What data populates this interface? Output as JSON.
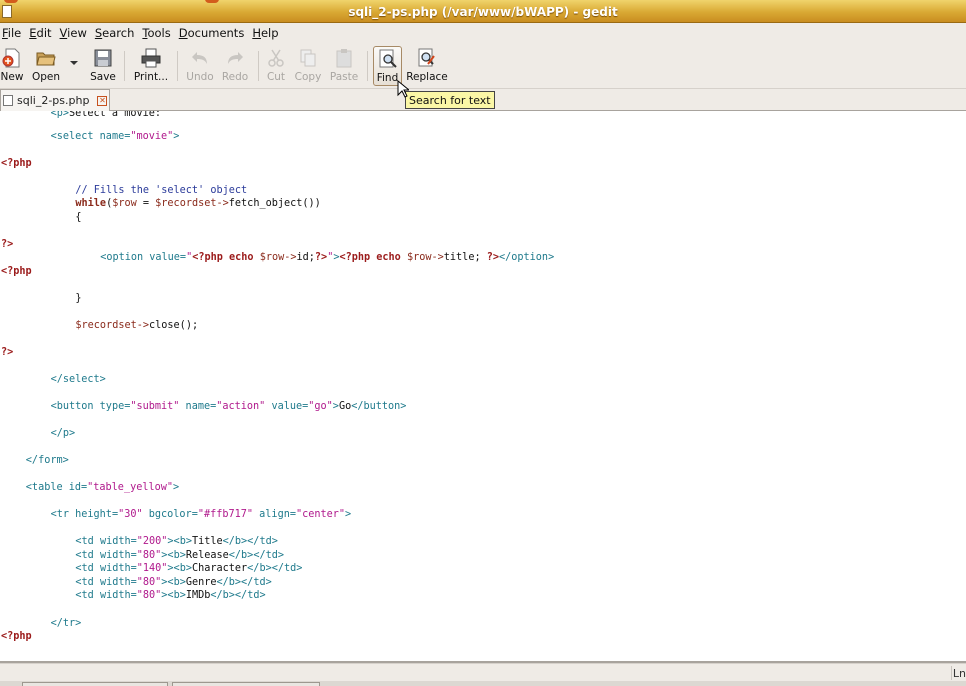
{
  "window": {
    "title": "sqli_2-ps.php (/var/www/bWAPP) - gedit"
  },
  "menu": [
    {
      "mnemonic": "F",
      "rest": "ile"
    },
    {
      "mnemonic": "E",
      "rest": "dit"
    },
    {
      "mnemonic": "V",
      "rest": "iew"
    },
    {
      "mnemonic": "S",
      "rest": "earch"
    },
    {
      "mnemonic": "T",
      "rest": "ools"
    },
    {
      "mnemonic": "D",
      "rest": "ocuments"
    },
    {
      "mnemonic": "H",
      "rest": "elp"
    }
  ],
  "toolbar": {
    "new": "New",
    "open": "Open",
    "save": "Save",
    "print": "Print...",
    "undo": "Undo",
    "redo": "Redo",
    "cut": "Cut",
    "copy": "Copy",
    "paste": "Paste",
    "find": "Find",
    "replace": "Replace"
  },
  "tooltip": "Search for text",
  "tab": {
    "label": "sqli_2-ps.php"
  },
  "status": {
    "position": "Ln"
  },
  "code": [
    {
      "t": [
        [
          "tk-tag",
          "<p>"
        ],
        [
          "tk-txt",
          "Select a movie:"
        ]
      ],
      "indent": 8
    },
    {
      "t": [
        [
          "tk-tag",
          "<select "
        ],
        [
          "tk-attr",
          "name="
        ],
        [
          "tk-str",
          "\"movie\""
        ],
        [
          "tk-tag",
          ">"
        ]
      ],
      "indent": 8
    },
    {
      "t": [
        [
          "tk-php",
          "<?php"
        ]
      ],
      "indent": 0
    },
    {
      "t": [
        [
          "tk-cmt",
          "// Fills the 'select' object"
        ]
      ],
      "indent": 12
    },
    {
      "t": [
        [
          "tk-kw",
          "while"
        ],
        [
          "tk-txt",
          "("
        ],
        [
          "tk-var",
          "$row"
        ],
        [
          "tk-txt",
          " = "
        ],
        [
          "tk-var",
          "$recordset"
        ],
        [
          "tk-op",
          "->"
        ],
        [
          "tk-txt",
          "fetch_object())"
        ]
      ],
      "indent": 12
    },
    {
      "t": [
        [
          "tk-txt",
          "{"
        ]
      ],
      "indent": 12
    },
    {
      "t": [
        [
          "tk-php",
          "?>"
        ]
      ],
      "indent": 0
    },
    {
      "t": [
        [
          "tk-tag",
          "<option "
        ],
        [
          "tk-attr",
          "value="
        ],
        [
          "tk-str",
          "\""
        ],
        [
          "tk-php",
          "<?php echo "
        ],
        [
          "tk-var",
          "$row"
        ],
        [
          "tk-op",
          "->"
        ],
        [
          "tk-txt",
          "id;"
        ],
        [
          "tk-php",
          "?>"
        ],
        [
          "tk-str",
          "\""
        ],
        [
          "tk-tag",
          ">"
        ],
        [
          "tk-php",
          "<?php echo "
        ],
        [
          "tk-var",
          "$row"
        ],
        [
          "tk-op",
          "->"
        ],
        [
          "tk-txt",
          "title; "
        ],
        [
          "tk-php",
          "?>"
        ],
        [
          "tk-tag",
          "</option>"
        ]
      ],
      "indent": 16
    },
    {
      "t": [
        [
          "tk-php",
          "<?php"
        ]
      ],
      "indent": 0
    },
    {
      "t": [
        [
          "tk-txt",
          "}"
        ]
      ],
      "indent": 12
    },
    {
      "t": [
        [
          "tk-var",
          "$recordset"
        ],
        [
          "tk-op",
          "->"
        ],
        [
          "tk-txt",
          "close();"
        ]
      ],
      "indent": 12
    },
    {
      "t": [
        [
          "tk-php",
          "?>"
        ]
      ],
      "indent": 0
    },
    {
      "t": [
        [
          "tk-tag",
          "</select>"
        ]
      ],
      "indent": 8
    },
    {
      "t": [
        [
          "tk-tag",
          "<button "
        ],
        [
          "tk-attr",
          "type="
        ],
        [
          "tk-str",
          "\"submit\""
        ],
        [
          "tk-attr",
          " name="
        ],
        [
          "tk-str",
          "\"action\""
        ],
        [
          "tk-attr",
          " value="
        ],
        [
          "tk-str",
          "\"go\""
        ],
        [
          "tk-tag",
          ">"
        ],
        [
          "tk-txt",
          "Go"
        ],
        [
          "tk-tag",
          "</button>"
        ]
      ],
      "indent": 8
    },
    {
      "t": [
        [
          "tk-tag",
          "</p>"
        ]
      ],
      "indent": 8
    },
    {
      "t": [
        [
          "tk-tag",
          "</form>"
        ]
      ],
      "indent": 4
    },
    {
      "t": [
        [
          "tk-tag",
          "<table "
        ],
        [
          "tk-attr",
          "id="
        ],
        [
          "tk-str",
          "\"table_yellow\""
        ],
        [
          "tk-tag",
          ">"
        ]
      ],
      "indent": 4
    },
    {
      "t": [
        [
          "tk-tag",
          "<tr "
        ],
        [
          "tk-attr",
          "height="
        ],
        [
          "tk-str",
          "\"30\""
        ],
        [
          "tk-attr",
          " bgcolor="
        ],
        [
          "tk-str",
          "\"#ffb717\""
        ],
        [
          "tk-attr",
          " align="
        ],
        [
          "tk-str",
          "\"center\""
        ],
        [
          "tk-tag",
          ">"
        ]
      ],
      "indent": 8
    },
    {
      "t": [
        [
          "tk-tag",
          "<td "
        ],
        [
          "tk-attr",
          "width="
        ],
        [
          "tk-str",
          "\"200\""
        ],
        [
          "tk-tag",
          "><b>"
        ],
        [
          "tk-txt",
          "Title"
        ],
        [
          "tk-tag",
          "</b></td>"
        ]
      ],
      "indent": 12
    },
    {
      "t": [
        [
          "tk-tag",
          "<td "
        ],
        [
          "tk-attr",
          "width="
        ],
        [
          "tk-str",
          "\"80\""
        ],
        [
          "tk-tag",
          "><b>"
        ],
        [
          "tk-txt",
          "Release"
        ],
        [
          "tk-tag",
          "</b></td>"
        ]
      ],
      "indent": 12
    },
    {
      "t": [
        [
          "tk-tag",
          "<td "
        ],
        [
          "tk-attr",
          "width="
        ],
        [
          "tk-str",
          "\"140\""
        ],
        [
          "tk-tag",
          "><b>"
        ],
        [
          "tk-txt",
          "Character"
        ],
        [
          "tk-tag",
          "</b></td>"
        ]
      ],
      "indent": 12
    },
    {
      "t": [
        [
          "tk-tag",
          "<td "
        ],
        [
          "tk-attr",
          "width="
        ],
        [
          "tk-str",
          "\"80\""
        ],
        [
          "tk-tag",
          "><b>"
        ],
        [
          "tk-txt",
          "Genre"
        ],
        [
          "tk-tag",
          "</b></td>"
        ]
      ],
      "indent": 12
    },
    {
      "t": [
        [
          "tk-tag",
          "<td "
        ],
        [
          "tk-attr",
          "width="
        ],
        [
          "tk-str",
          "\"80\""
        ],
        [
          "tk-tag",
          "><b>"
        ],
        [
          "tk-txt",
          "IMDb"
        ],
        [
          "tk-tag",
          "</b></td>"
        ]
      ],
      "indent": 12
    },
    {
      "t": [
        [
          "tk-tag",
          "</tr>"
        ]
      ],
      "indent": 8
    },
    {
      "t": [
        [
          "tk-php",
          "<?php"
        ]
      ],
      "indent": 0
    }
  ]
}
